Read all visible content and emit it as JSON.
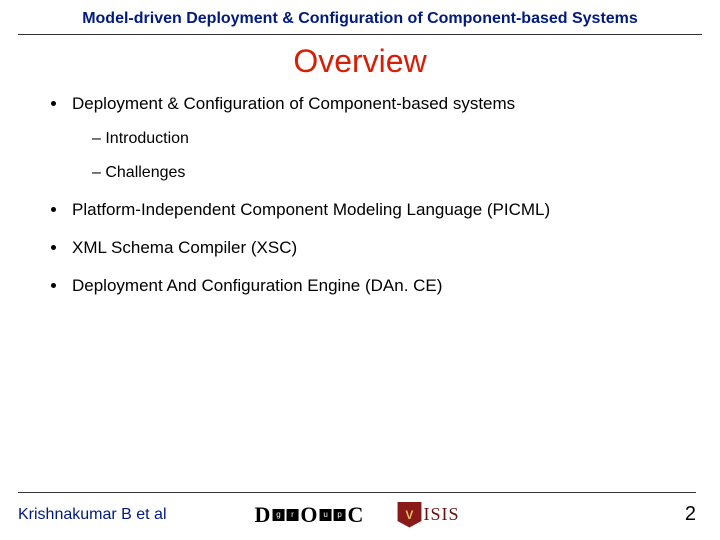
{
  "header": {
    "title": "Model-driven Deployment & Configuration of Component-based Systems"
  },
  "slide": {
    "title": "Overview"
  },
  "bullets": {
    "b1": "Deployment & Configuration of Component-based systems",
    "b1a": "Introduction",
    "b1b": "Challenges",
    "b2": "Platform-Independent Component Modeling Language (PICML)",
    "b3": "XML Schema Compiler (XSC)",
    "b4": "Deployment And Configuration Engine (DAn. CE)"
  },
  "footer": {
    "author": "Krishnakumar B et al",
    "page": "2"
  },
  "logos": {
    "doc": {
      "d": "D",
      "o": "O",
      "c": "C",
      "g": "g",
      "r": "r",
      "u": "u",
      "p": "p"
    },
    "isis": {
      "shield": "V",
      "text": "ISIS"
    }
  }
}
